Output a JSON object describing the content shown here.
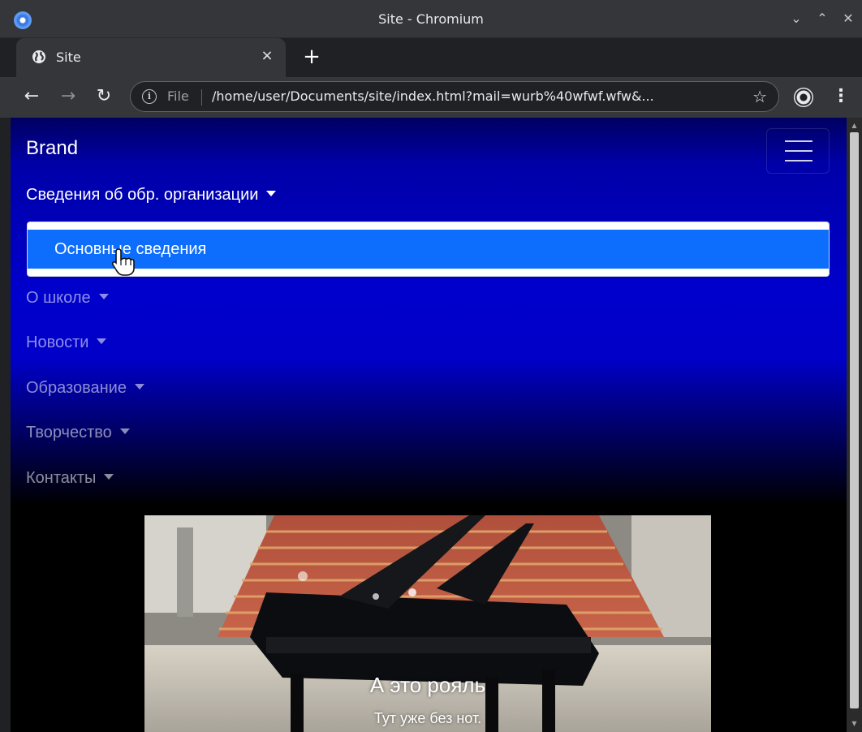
{
  "window": {
    "title": "Site - Chromium",
    "controls": {
      "minimize": "⌄",
      "maximize": "⌃",
      "close": "✕"
    }
  },
  "tabs": [
    {
      "title": "Site",
      "close": "×"
    }
  ],
  "new_tab": "+",
  "toolbar": {
    "back": "←",
    "forward": "→",
    "reload": "↻",
    "info_icon": "i",
    "scheme": "File",
    "url": "/home/user/Documents/site/index.html?mail=wurb%40wfwf.wfw&...",
    "star": "☆",
    "menu": "⋮"
  },
  "page": {
    "brand": "Brand",
    "nav_items": [
      {
        "label": "Сведения об обр. организации",
        "active": true
      },
      {
        "label": "О школе",
        "active": false
      },
      {
        "label": "Новости",
        "active": false
      },
      {
        "label": "Образование",
        "active": false
      },
      {
        "label": "Творчество",
        "active": false
      },
      {
        "label": "Контакты",
        "active": false
      }
    ],
    "dropdown": {
      "items": [
        {
          "label": "Основные сведения",
          "highlighted": true
        }
      ]
    },
    "carousel": {
      "caption_title": "А это рояль",
      "caption_text": "Тут уже без нот."
    }
  },
  "colors": {
    "dropdown_highlight": "#0d6efd",
    "navbar_mid": "#0000cc"
  }
}
